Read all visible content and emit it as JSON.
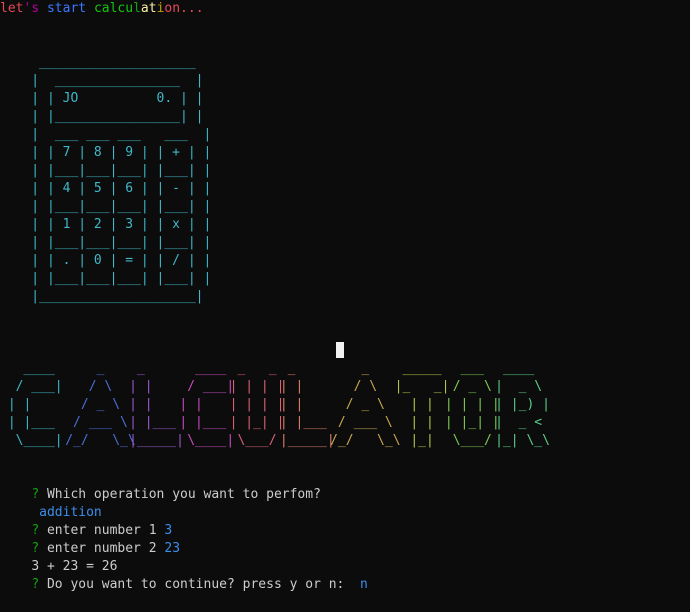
{
  "intro": {
    "chars": [
      {
        "c": "l",
        "color": "#e74856"
      },
      {
        "c": "e",
        "color": "#e74856"
      },
      {
        "c": "t",
        "color": "#e74856"
      },
      {
        "c": "'",
        "color": "#b4009e"
      },
      {
        "c": "s",
        "color": "#b4009e"
      },
      {
        "c": " ",
        "color": "#cccccc"
      },
      {
        "c": "s",
        "color": "#3b78ff"
      },
      {
        "c": "t",
        "color": "#3b78ff"
      },
      {
        "c": "a",
        "color": "#3b78ff"
      },
      {
        "c": "r",
        "color": "#3b78ff"
      },
      {
        "c": "t",
        "color": "#3b78ff"
      },
      {
        "c": " ",
        "color": "#cccccc"
      },
      {
        "c": "c",
        "color": "#16c60c"
      },
      {
        "c": "a",
        "color": "#16c60c"
      },
      {
        "c": "l",
        "color": "#16c60c"
      },
      {
        "c": "c",
        "color": "#16c60c"
      },
      {
        "c": "u",
        "color": "#16c60c"
      },
      {
        "c": "l",
        "color": "#13a10e"
      },
      {
        "c": "a",
        "color": "#f9f1a5"
      },
      {
        "c": "t",
        "color": "#f9f1a5"
      },
      {
        "c": "i",
        "color": "#c19c00"
      },
      {
        "c": "o",
        "color": "#e74856"
      },
      {
        "c": "n",
        "color": "#e74856"
      },
      {
        "c": ".",
        "color": "#e74856"
      },
      {
        "c": ".",
        "color": "#e74856"
      },
      {
        "c": ".",
        "color": "#e74856"
      }
    ]
  },
  "calculator_art": {
    "color": "#3fb8c9",
    "lines": [
      "     ____________________",
      "    |  ________________  |",
      "    | | JO          0. | |",
      "    | |________________| |",
      "    |  ___ ___ ___   ___  |",
      "    | | 7 | 8 | 9 | | + | |",
      "    | |___|___|___| |___| |",
      "    | | 4 | 5 | 6 | | - | |",
      "    | |___|___|___| |___| |",
      "    | | 1 | 2 | 3 | | x | |",
      "    | |___|___|___| |___| |",
      "    | | . | 0 | = | | / | |",
      "    | |___|___|___| |___| |",
      "    |____________________|"
    ]
  },
  "banner": {
    "letters": [
      {
        "name": "C",
        "color": "#3fb8c9",
        "lines": [
          "   ____ ",
          "  / ___|",
          " | |    ",
          " | |___ ",
          "  \\____|"
        ]
      },
      {
        "name": "A",
        "color": "#4c6fd8",
        "lines": [
          "     _    ",
          "    / \\   ",
          "   / _ \\  ",
          "  / ___ \\ ",
          " /_/   \\_\\"
        ]
      },
      {
        "name": "L",
        "color": "#9b59d0",
        "lines": [
          " _     ",
          "| |    ",
          "| |    ",
          "| |___ ",
          "|_____|"
        ]
      },
      {
        "name": "C",
        "color": "#c84bbf",
        "lines": [
          "  ____ ",
          " / ___|",
          "| |    ",
          "| |___ ",
          " \\____|"
        ]
      },
      {
        "name": "U",
        "color": "#d9607a",
        "lines": [
          " _   _ ",
          "| | | |",
          "| | | |",
          "| |_| |",
          " \\___/ "
        ]
      },
      {
        "name": "L",
        "color": "#d9806a",
        "lines": [
          " _     ",
          "| |    ",
          "| |    ",
          "| |___ ",
          "|_____|"
        ]
      },
      {
        "name": "A",
        "color": "#c9a84e",
        "lines": [
          "    _    ",
          "   / \\   ",
          "  / _ \\  ",
          " / ___ \\ ",
          "/_/   \\_\\"
        ]
      },
      {
        "name": "T",
        "color": "#b7c24a",
        "lines": [
          " _____ ",
          "|_   _|",
          "  | |  ",
          "  | |  ",
          "  |_|  "
        ]
      },
      {
        "name": "O",
        "color": "#7ccb53",
        "lines": [
          "  ___  ",
          " / _ \\ ",
          "| | | |",
          "| |_| |",
          " \\___/ "
        ]
      },
      {
        "name": "R",
        "color": "#5ccf8a",
        "lines": [
          " ____  ",
          "|  _ \\ ",
          "| |_) |",
          "|  _ < ",
          "|_| \\_\\"
        ]
      }
    ]
  },
  "session": {
    "prompt_mark": "?",
    "q1": " Which operation you want to perfom?",
    "a1": " addition",
    "q2": " enter number 1",
    "a2": "3",
    "q3": " enter number 2",
    "a3": "23",
    "result": "3 + 23 = 26",
    "q4": " Do you want to continue? press y or n:",
    "a4": "n"
  }
}
